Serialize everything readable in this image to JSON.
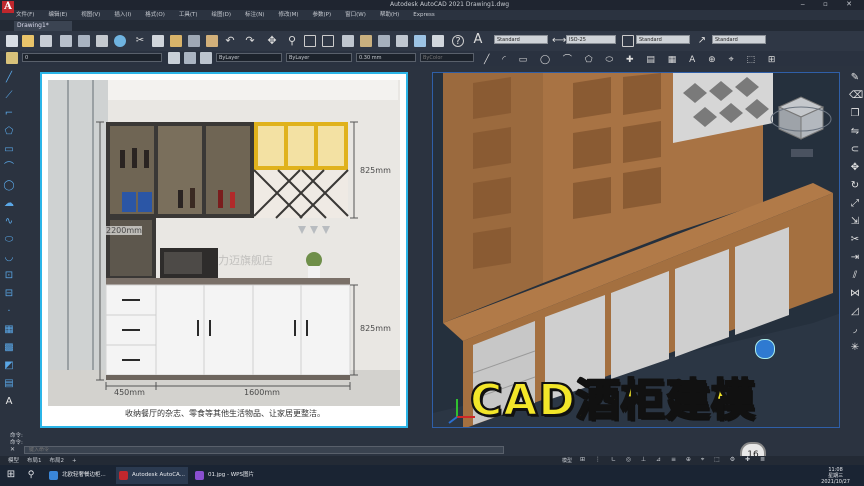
{
  "app": {
    "logo_letter": "A",
    "title": "Autodesk AutoCAD 2021    Drawing1.dwg",
    "doc_tab": "Drawing1*",
    "menus": [
      "文件(F)",
      "编辑(E)",
      "视图(V)",
      "插入(I)",
      "格式(O)",
      "工具(T)",
      "绘图(D)",
      "标注(N)",
      "修改(M)",
      "参数(P)",
      "窗口(W)",
      "帮助(H)",
      "Express"
    ]
  },
  "ribbon": {
    "layer_value": "0",
    "color_value": "ByLayer",
    "linetype_value": "ByLayer",
    "lineweight_value": "0.30 mm",
    "plotstyle_value": "ByColor",
    "text_style": "Standard",
    "dim_style": "ISO-25",
    "table_style": "Standard",
    "mleader_style": "Standard"
  },
  "left_view": {
    "dimensions": {
      "upper_height": "825mm",
      "lower_height": "825mm",
      "total_height": "2200mm",
      "left_width": "450mm",
      "right_width": "1600mm"
    },
    "watermark": "力迈旗舰店",
    "caption": "收纳餐厅的杂志、零食等其他生活物品、让家居更整洁。"
  },
  "right_view": {
    "overlay_title": "CAD酒柜建模",
    "badge": "16"
  },
  "command": {
    "line1": "命令:",
    "line2": "命令:",
    "placeholder": "键入命令"
  },
  "layout_tabs": [
    "模型",
    "布局1",
    "布局2",
    "+"
  ],
  "status_text": "模型",
  "taskbar": {
    "items": [
      "北欧轻奢餐边柜...",
      "Autodesk AutoCA...",
      "01.jpg - WPS图片"
    ],
    "time": "11:08",
    "weekday": "星期三",
    "date": "2021/10/27"
  },
  "colors": {
    "accent_blue": "#2bb5e8",
    "title_yellow": "#f3e629",
    "wood": "#a87344",
    "cabinet_white": "#c9c9c9"
  }
}
